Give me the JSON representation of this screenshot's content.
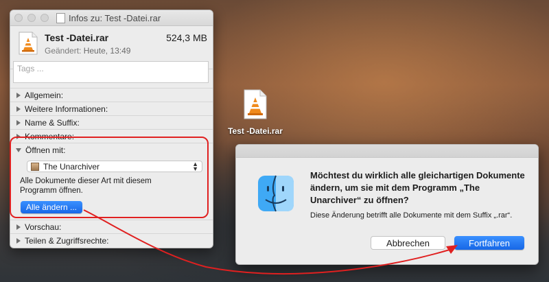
{
  "window": {
    "title": "Infos zu: Test -Datei.rar"
  },
  "file": {
    "name": "Test -Datei.rar",
    "size": "524,3 MB",
    "modified_label": "Geändert:",
    "modified_value": "Heute, 13:49",
    "tags_placeholder": "Tags ..."
  },
  "sections": [
    {
      "label": "Allgemein:",
      "expanded": false
    },
    {
      "label": "Weitere Informationen:",
      "expanded": false
    },
    {
      "label": "Name & Suffix:",
      "expanded": false
    },
    {
      "label": "Kommentare:",
      "expanded": false
    },
    {
      "label": "Öffnen mit:",
      "expanded": true
    },
    {
      "label": "Vorschau:",
      "expanded": false
    },
    {
      "label": "Teilen & Zugriffsrechte:",
      "expanded": false
    }
  ],
  "open_with": {
    "selected_app": "The Unarchiver",
    "description": "Alle Dokumente dieser Art mit diesem Programm öffnen.",
    "change_all_label": "Alle ändern ..."
  },
  "desktop": {
    "file_label": "Test -Datei.rar"
  },
  "dialog": {
    "heading": "Möchtest du wirklich alle gleichartigen Dokumente ändern, um sie mit dem Programm „The Unarchiver“ zu öffnen?",
    "body": "Diese Änderung betrifft alle Dokumente mit dem Suffix „.rar“.",
    "cancel_label": "Abbrechen",
    "continue_label": "Fortfahren"
  },
  "colors": {
    "accent_blue": "#1a6ef0",
    "annotation_red": "#e02020"
  },
  "icons": {
    "file": "vlc-cone-document-icon",
    "dialog": "finder-icon"
  }
}
